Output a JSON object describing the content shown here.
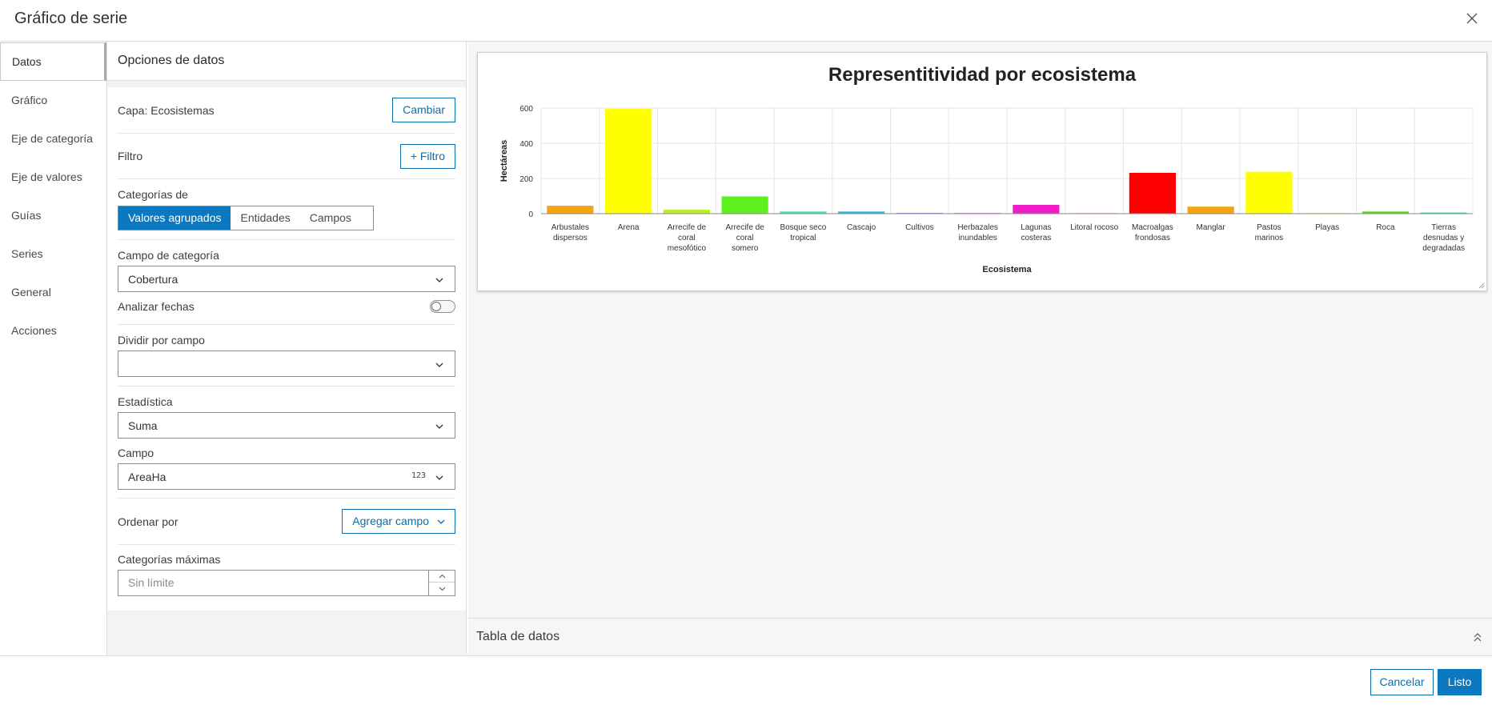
{
  "dialog": {
    "title": "Gráfico de serie"
  },
  "nav": {
    "items": [
      {
        "label": "Datos",
        "active": true
      },
      {
        "label": "Gráfico"
      },
      {
        "label": "Eje de categoría"
      },
      {
        "label": "Eje de valores"
      },
      {
        "label": "Guías"
      },
      {
        "label": "Series"
      },
      {
        "label": "General"
      },
      {
        "label": "Acciones"
      }
    ]
  },
  "options": {
    "header": "Opciones de datos",
    "layer_label": "Capa: Ecosistemas",
    "change_button": "Cambiar",
    "filter_label": "Filtro",
    "filter_button": "+ Filtro",
    "categories_label": "Categorías de",
    "categories_segments": [
      "Valores agrupados",
      "Entidades",
      "Campos"
    ],
    "categories_selected": "Valores agrupados",
    "category_field_label": "Campo de categoría",
    "category_field_value": "Cobertura",
    "analyze_dates_label": "Analizar fechas",
    "analyze_dates_on": false,
    "split_by_label": "Dividir por campo",
    "split_by_value": "",
    "statistic_label": "Estadística",
    "statistic_value": "Suma",
    "field_label": "Campo",
    "field_value": "AreaHa",
    "field_type_badge": "123",
    "sort_label": "Ordenar por",
    "sort_button": "Agregar campo",
    "max_categories_label": "Categorías máximas",
    "max_categories_placeholder": "Sin límite"
  },
  "preview": {
    "data_table_label": "Tabla de datos"
  },
  "footer": {
    "cancel": "Cancelar",
    "ok": "Listo"
  },
  "chart_data": {
    "type": "bar",
    "title": "Representitividad por ecosistema",
    "xlabel": "Ecosistema",
    "ylabel": "Hectáreas",
    "ylim": [
      0,
      600
    ],
    "yticks": [
      0,
      200,
      400,
      600
    ],
    "grid": true,
    "categories": [
      "Arbustales dispersos",
      "Arena",
      "Arrecife de coral mesofótico",
      "Arrecife de coral somero",
      "Bosque seco tropical",
      "Cascajo",
      "Cultivos",
      "Herbazales inundables",
      "Lagunas costeras",
      "Litoral rocoso",
      "Macroalgas frondosas",
      "Manglar",
      "Pastos marinos",
      "Playas",
      "Roca",
      "Tierras desnudas y degradadas"
    ],
    "category_lines": [
      [
        "Arbustales",
        "dispersos"
      ],
      [
        "Arena"
      ],
      [
        "Arrecife de",
        "coral",
        "mesofótico"
      ],
      [
        "Arrecife de",
        "coral",
        "somero"
      ],
      [
        "Bosque seco",
        "tropical"
      ],
      [
        "Cascajo"
      ],
      [
        "Cultivos"
      ],
      [
        "Herbazales",
        "inundables"
      ],
      [
        "Lagunas",
        "costeras"
      ],
      [
        "Litoral rocoso"
      ],
      [
        "Macroalgas",
        "frondosas"
      ],
      [
        "Manglar"
      ],
      [
        "Pastos",
        "marinos"
      ],
      [
        "Playas"
      ],
      [
        "Roca"
      ],
      [
        "Tierras",
        "desnudas y",
        "degradadas"
      ]
    ],
    "values": [
      45,
      595,
      22,
      98,
      12,
      12,
      4,
      4,
      50,
      3,
      232,
      40,
      238,
      3,
      12,
      6
    ],
    "colors": [
      "#f5a311",
      "#ffff00",
      "#b8f01e",
      "#5ef01e",
      "#3ee0b8",
      "#2ab8e0",
      "#6a78f0",
      "#d16af0",
      "#f01ec8",
      "#f06a6a",
      "#ff0000",
      "#f5a311",
      "#ffff00",
      "#c8e01e",
      "#5ed61e",
      "#1ed6a8"
    ]
  }
}
